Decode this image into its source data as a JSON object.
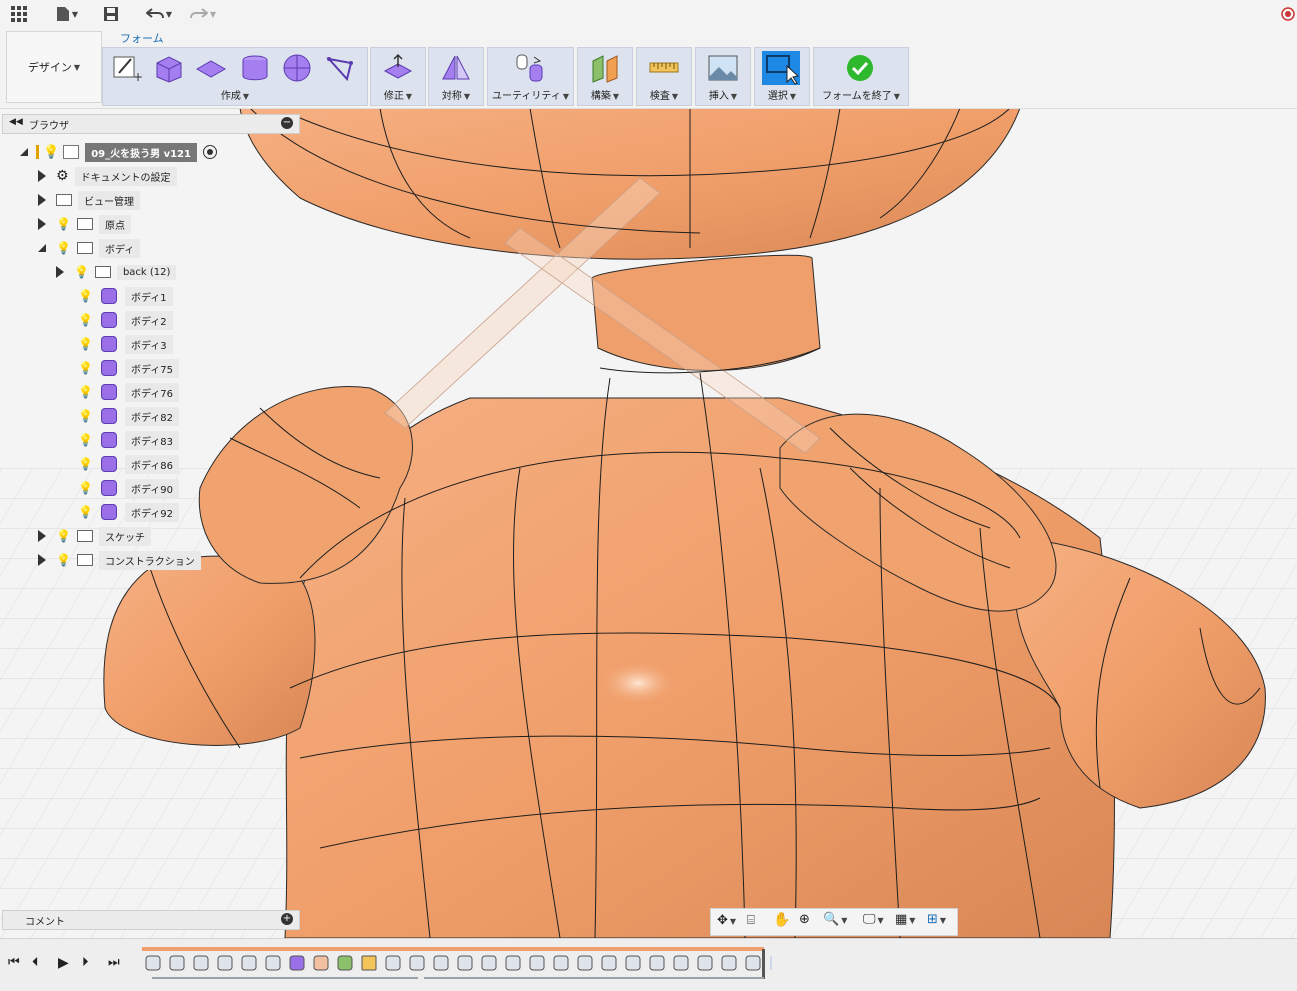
{
  "workspace": {
    "label": "デザイン"
  },
  "ribbon": {
    "active_tab": "フォーム",
    "groups": [
      {
        "label": "作成"
      },
      {
        "label": "修正"
      },
      {
        "label": "対称"
      },
      {
        "label": "ユーティリティ"
      },
      {
        "label": "構築"
      },
      {
        "label": "検査"
      },
      {
        "label": "挿入"
      },
      {
        "label": "選択"
      },
      {
        "label": "フォームを終了"
      }
    ]
  },
  "browser": {
    "title": "ブラウザ",
    "root": "09_火を扱う男 v121",
    "items": [
      "ドキュメントの設定",
      "ビュー管理",
      "原点",
      "ボディ",
      "back (12)",
      "ボディ1",
      "ボディ2",
      "ボディ3",
      "ボディ75",
      "ボディ76",
      "ボディ82",
      "ボディ83",
      "ボディ86",
      "ボディ90",
      "ボディ92",
      "スケッチ",
      "コンストラクション"
    ]
  },
  "comments": {
    "label": "コメント"
  },
  "colors": {
    "body": "#f0a06c",
    "accent": "#1a6fb5",
    "select_blue": "#1e88e5"
  }
}
